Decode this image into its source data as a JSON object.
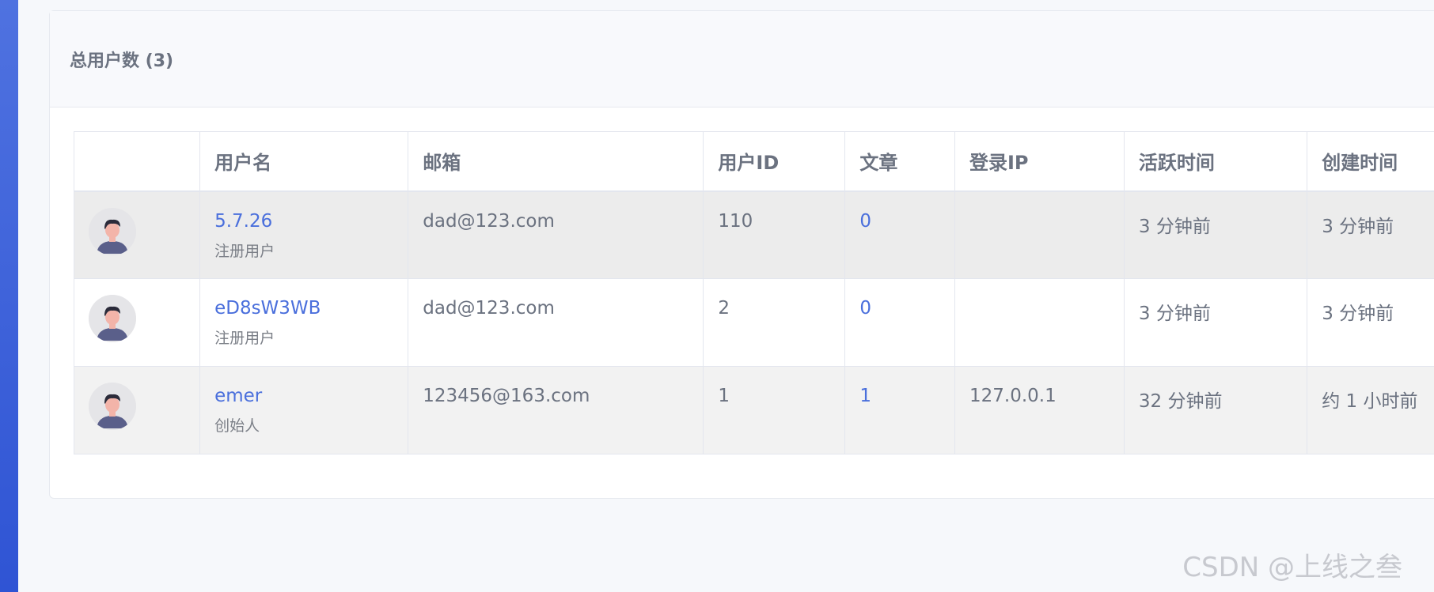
{
  "header": {
    "title": "总用户数 (3)"
  },
  "table": {
    "columns": [
      "",
      "用户名",
      "邮箱",
      "用户ID",
      "文章",
      "登录IP",
      "活跃时间",
      "创建时间"
    ],
    "rows": [
      {
        "username": "5.7.26",
        "role": "注册用户",
        "email": "dad@123.com",
        "user_id": "110",
        "articles": "0",
        "login_ip": "",
        "active_time": "3 分钟前",
        "created_time": "3 分钟前"
      },
      {
        "username": "eD8sW3WB",
        "role": "注册用户",
        "email": "dad@123.com",
        "user_id": "2",
        "articles": "0",
        "login_ip": "",
        "active_time": "3 分钟前",
        "created_time": "3 分钟前"
      },
      {
        "username": "emer",
        "role": "创始人",
        "email": "123456@163.com",
        "user_id": "1",
        "articles": "1",
        "login_ip": "127.0.0.1",
        "active_time": "32 分钟前",
        "created_time": "约 1 小时前"
      }
    ]
  },
  "watermark": "CSDN @上线之叁",
  "colors": {
    "accent": "#4a6fdc",
    "rail": "#2f54d4"
  },
  "icons": {
    "avatar": "user-avatar-icon"
  }
}
